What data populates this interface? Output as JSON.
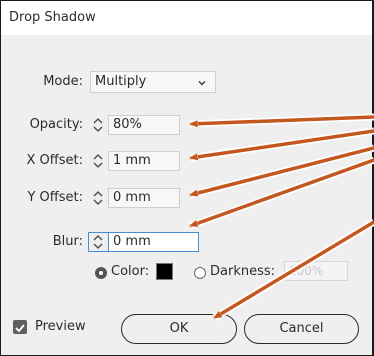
{
  "dialog": {
    "title": "Drop Shadow"
  },
  "mode": {
    "label": "Mode:",
    "value": "Multiply"
  },
  "opacity": {
    "label": "Opacity:",
    "value": "80%"
  },
  "x_offset": {
    "label": "X Offset:",
    "value": "1 mm"
  },
  "y_offset": {
    "label": "Y Offset:",
    "value": "0 mm"
  },
  "blur": {
    "label": "Blur:",
    "value": "0 mm"
  },
  "color_option": {
    "label": "Color:",
    "selected": true,
    "swatch": "#000000"
  },
  "darkness_option": {
    "label": "Darkness:",
    "value": "100%",
    "selected": false
  },
  "preview": {
    "label": "Preview",
    "checked": true
  },
  "buttons": {
    "ok": "OK",
    "cancel": "Cancel"
  },
  "colors": {
    "arrow": "#c4561f",
    "focus": "#4a8bd6"
  }
}
